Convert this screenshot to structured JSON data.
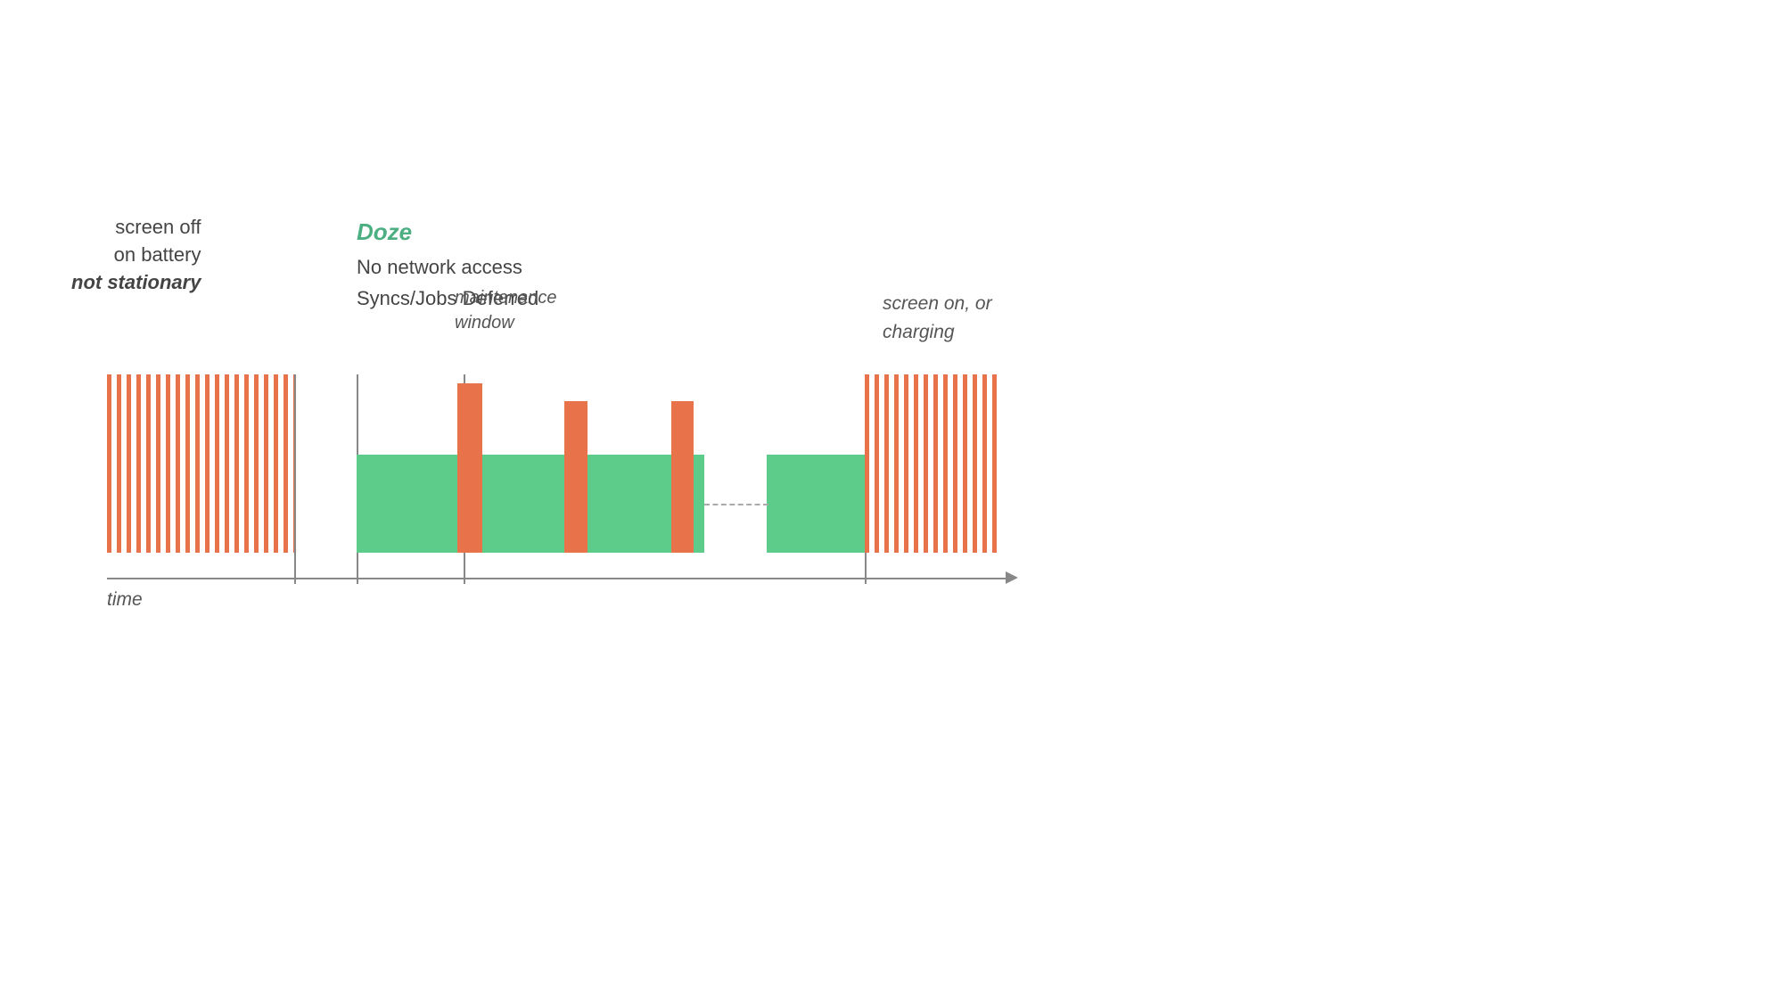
{
  "labels": {
    "screen_off_line1": "screen off",
    "screen_off_line2": "on battery",
    "screen_off_line3": "not stationary",
    "doze_title": "Doze",
    "doze_line1": "No network access",
    "doze_line2": "Syncs/Jobs Deferred",
    "maintenance_line1": "maintenance",
    "maintenance_line2": "window",
    "screen_on": "screen on, or",
    "charging": "charging",
    "time": "time"
  },
  "colors": {
    "orange": "#e8734a",
    "green": "#5dcb8a",
    "doze_title": "#4caf82",
    "axis": "#888888",
    "text": "#444444",
    "text_light": "#555555"
  }
}
